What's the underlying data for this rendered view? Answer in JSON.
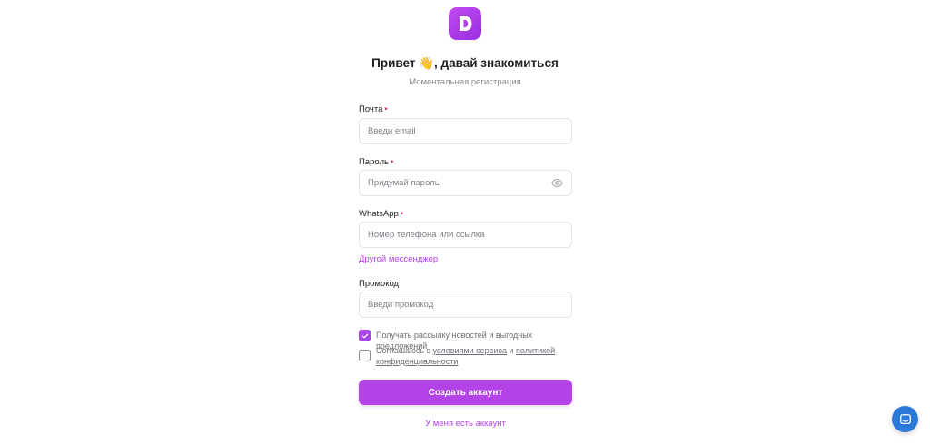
{
  "header": {
    "logo_icon": "brand-d-icon",
    "title": "Привет 👋, давай знакомиться",
    "subtitle": "Моментальная регистрация"
  },
  "form": {
    "email": {
      "label": "Почта",
      "required_mark": "•",
      "placeholder": "Введи email",
      "value": ""
    },
    "password": {
      "label": "Пароль",
      "required_mark": "•",
      "placeholder": "Придумай пароль",
      "value": "",
      "toggle_icon": "eye-icon"
    },
    "whatsapp": {
      "label": "WhatsApp",
      "required_mark": "•",
      "placeholder": "Номер телефона или ссылка",
      "value": ""
    },
    "other_messenger_link": "Другой мессенджер",
    "promo": {
      "label": "Промокод",
      "placeholder": "Введи промокод",
      "value": ""
    },
    "newsletter": {
      "checked": true,
      "text": "Получать рассылку новостей и выгодных предложений"
    },
    "terms": {
      "checked": false,
      "prefix": "Соглашаюсь с ",
      "terms_link": "условиями сервиса",
      "middle": " и ",
      "privacy_link": "политикой конфиденциальности"
    },
    "submit_label": "Создать аккаунт",
    "login_link": "У меня есть аккаунт"
  },
  "support": {
    "chat_icon": "chat-icon"
  },
  "colors": {
    "accent": "#b444e8",
    "link": "#b13fe6",
    "required": "#e0245e",
    "chat": "#2a79d9"
  }
}
